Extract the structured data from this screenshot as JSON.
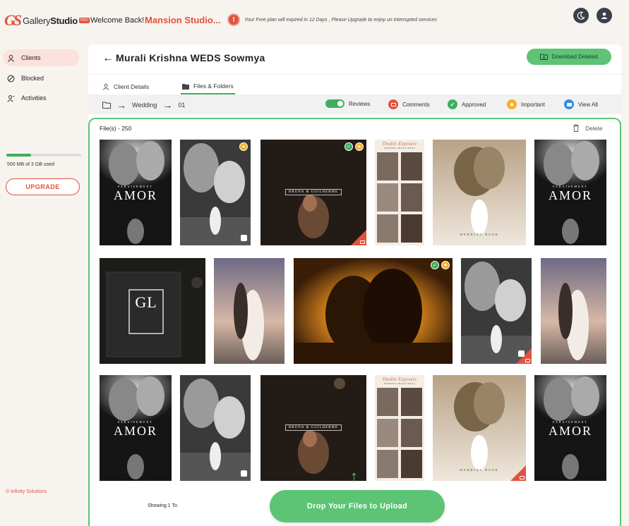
{
  "header": {
    "logo_mark": "GS",
    "logo_text_a": "Gallery",
    "logo_text_b": "Studio",
    "logo_badge": "PRO",
    "welcome": "Welcome Back!",
    "studio_name": "Mansion Studio...",
    "notice_icon": "!",
    "notice": "Your Free plan will expired in 12 Days , Please Upgrade to enjoy un interrupted services",
    "theme_icon": "moon-icon",
    "profile_icon": "user-icon"
  },
  "sidebar": {
    "items": [
      {
        "label": "Clients",
        "icon": "user-icon"
      },
      {
        "label": "Blocked",
        "icon": "block-icon"
      },
      {
        "label": "Activities",
        "icon": "user-activity-icon"
      }
    ],
    "storage_used_fraction": 0.33,
    "storage_text": "500 MB of 3 GB used",
    "upgrade_label": "UPGRADE",
    "copyright": "© Infinity Solutions"
  },
  "main": {
    "title": "Murali Krishna WEDS Sowmya",
    "download_label": "Download Deleted",
    "tabs": [
      {
        "label": "Client Details",
        "icon": "user-icon"
      },
      {
        "label": "Files & Folders",
        "icon": "folder-icon"
      }
    ],
    "breadcrumb": [
      "Wedding",
      "01"
    ],
    "legend": {
      "reviews": "Reviews",
      "comments": "Comments",
      "approved": "Approved",
      "important": "Important",
      "view_all": "View All"
    },
    "files_label": "File(s)  -  250",
    "delete_label": "Delete",
    "pager": "Showing 1 To",
    "drop_label": "Drop Your Files to Upload"
  },
  "posters": {
    "amor": "AMOR",
    "amor_top": "PARAISEMENT",
    "bruna": "BRUNA & GUILHERME",
    "double_exposure": "Double Exposure",
    "wedding_ideas": "WEDDING PHOTO IDEAS",
    "gl": "GL",
    "wedding_book": "WEDDING BOOK"
  },
  "colors": {
    "accent": "#e0533f",
    "green": "#5cc474",
    "approved": "#3fae5d",
    "important": "#f4b11e",
    "view_all": "#2f8fe0"
  }
}
